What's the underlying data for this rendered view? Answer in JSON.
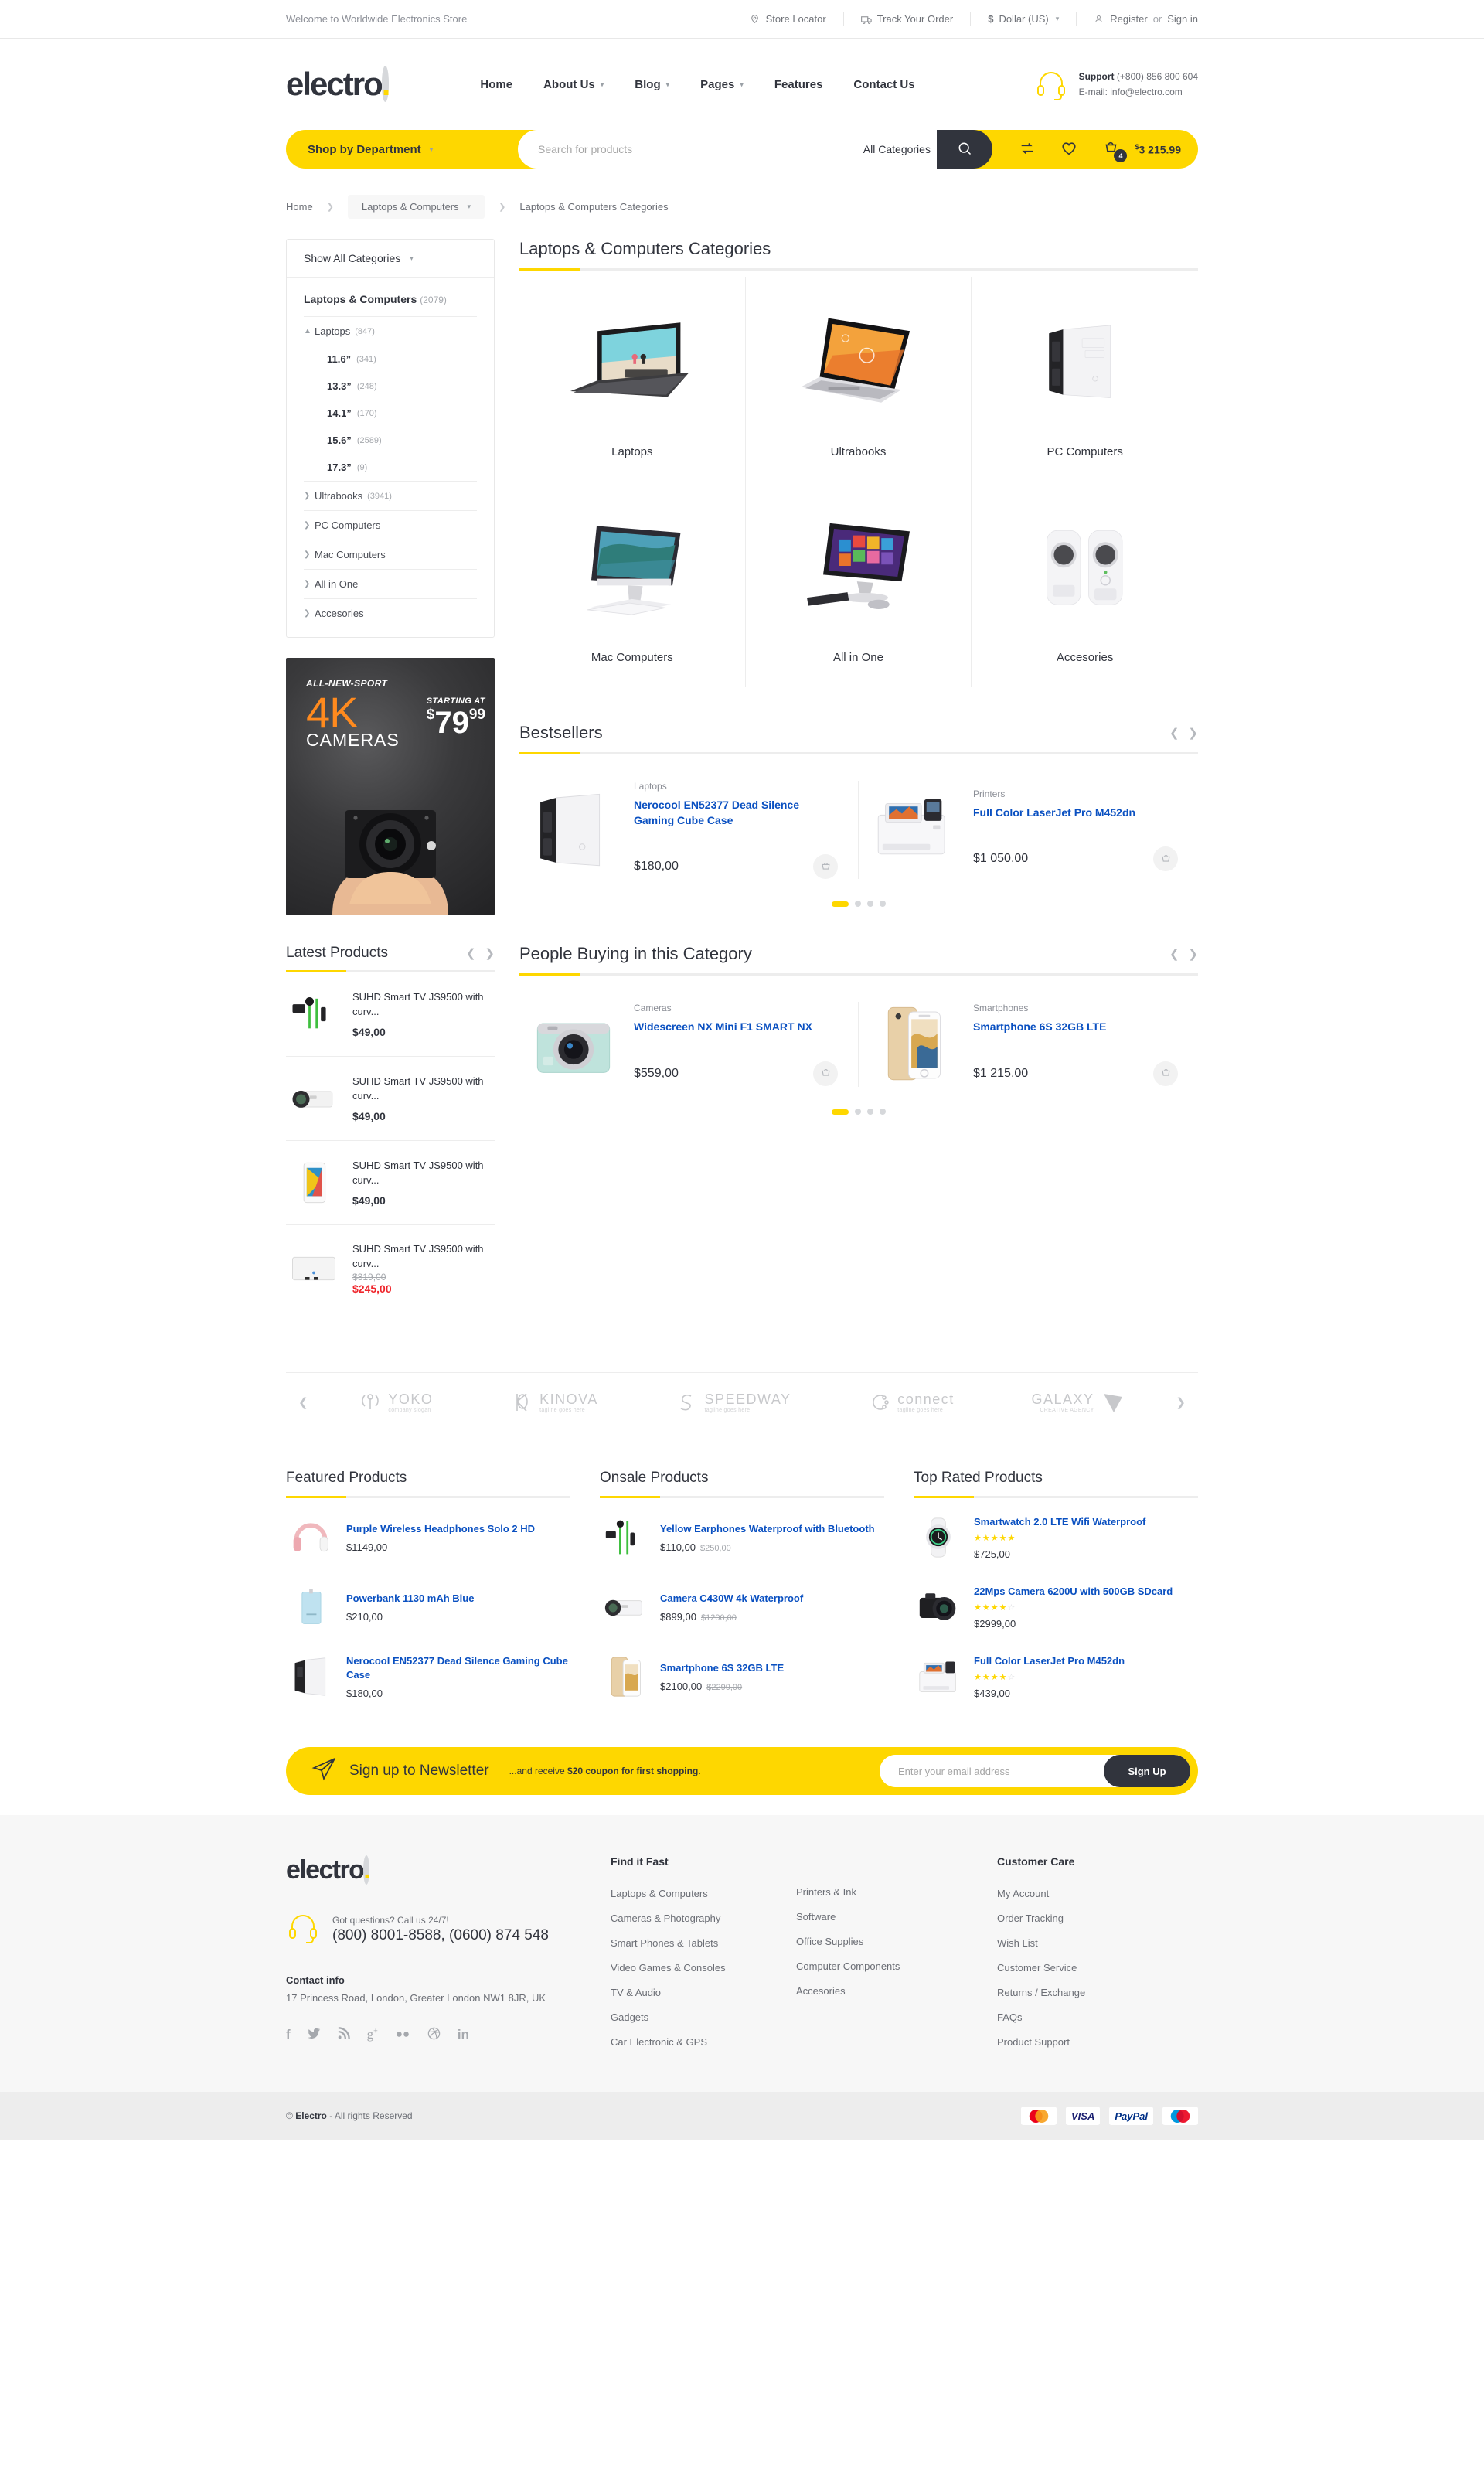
{
  "topbar": {
    "welcome": "Welcome to Worldwide Electronics Store",
    "store_locator": "Store Locator",
    "track_order": "Track Your Order",
    "currency": "Dollar (US)",
    "currency_symbol": "$",
    "register": "Register",
    "or": "or",
    "signin": "Sign in"
  },
  "header": {
    "logo": "electro",
    "logo_dot": ".",
    "nav": [
      {
        "label": "Home",
        "has_caret": false
      },
      {
        "label": "About Us",
        "has_caret": true
      },
      {
        "label": "Blog",
        "has_caret": true
      },
      {
        "label": "Pages",
        "has_caret": true
      },
      {
        "label": "Features",
        "has_caret": false
      },
      {
        "label": "Contact Us",
        "has_caret": false
      }
    ],
    "support_label": "Support",
    "support_phone": "(+800) 856 800 604",
    "support_email": "E-mail: info@electro.com"
  },
  "search": {
    "shop_by_department": "Shop by Department",
    "placeholder": "Search for products",
    "all_categories": "All Categories",
    "cart_count": "4",
    "cart_total": "3 215.99",
    "cart_currency": "$"
  },
  "breadcrumb": {
    "home": "Home",
    "current_dropdown": "Laptops & Computers",
    "page": "Laptops & Computers Categories"
  },
  "sidebar": {
    "show_all": "Show All Categories",
    "main_cat": "Laptops & Computers",
    "main_cat_count": "(2079)",
    "laptops": {
      "label": "Laptops",
      "count": "(847)"
    },
    "sizes": [
      {
        "label": "11.6”",
        "count": "(341)"
      },
      {
        "label": "13.3”",
        "count": "(248)"
      },
      {
        "label": "14.1”",
        "count": "(170)"
      },
      {
        "label": "15.6”",
        "count": "(2589)"
      },
      {
        "label": "17.3”",
        "count": "(9)"
      }
    ],
    "others": [
      {
        "label": "Ultrabooks",
        "count": "(3941)"
      },
      {
        "label": "PC Computers",
        "count": ""
      },
      {
        "label": "Mac Computers",
        "count": ""
      },
      {
        "label": "All in One",
        "count": ""
      },
      {
        "label": "Accesories",
        "count": ""
      }
    ]
  },
  "promo": {
    "kicker": "ALL-NEW-SPORT",
    "big": "4K",
    "cameras": "CAMERAS",
    "starting_at": "STARTING AT",
    "currency": "$",
    "price": "79",
    "cents": "99"
  },
  "latest_products": {
    "title": "Latest Products",
    "items": [
      {
        "name": "SUHD Smart TV JS9500 with curv...",
        "price": "$49,00",
        "old": "",
        "sale": ""
      },
      {
        "name": "SUHD Smart TV JS9500 with curv...",
        "price": "$49,00",
        "old": "",
        "sale": ""
      },
      {
        "name": "SUHD Smart TV JS9500 with curv...",
        "price": "$49,00",
        "old": "",
        "sale": ""
      },
      {
        "name": "SUHD Smart TV JS9500 with curv...",
        "price": "",
        "old": "$319,00",
        "sale": "$245,00"
      }
    ]
  },
  "categories_section": {
    "title": "Laptops & Computers Categories",
    "cards": [
      {
        "label": "Laptops"
      },
      {
        "label": "Ultrabooks"
      },
      {
        "label": "PC Computers"
      },
      {
        "label": "Mac Computers"
      },
      {
        "label": "All in One"
      },
      {
        "label": "Accesories"
      }
    ]
  },
  "bestsellers": {
    "title": "Bestsellers",
    "items": [
      {
        "category": "Laptops",
        "name": "Nerocool EN52377 Dead Silence Gaming Cube Case",
        "price": "$180,00"
      },
      {
        "category": "Printers",
        "name": "Full Color LaserJet Pro M452dn",
        "price": "$1 050,00"
      }
    ],
    "dots": 4,
    "active_dot": 0
  },
  "people_buying": {
    "title": "People Buying in this Category",
    "items": [
      {
        "category": "Cameras",
        "name": "Widescreen NX Mini F1 SMART NX",
        "price": "$559,00"
      },
      {
        "category": "Smartphones",
        "name": "Smartphone 6S 32GB LTE",
        "price": "$1 215,00"
      }
    ],
    "dots": 4,
    "active_dot": 0
  },
  "brands": [
    {
      "name": "YOKO",
      "tagline": "company slogan"
    },
    {
      "name": "KINOVA",
      "tagline": "tagline goes here"
    },
    {
      "name": "SPEEDWAY",
      "tagline": "tagline goes here"
    },
    {
      "name": "connect",
      "tagline": "tagline goes here"
    },
    {
      "name": "GALAXY",
      "tagline": "CREATIVE AGENCY"
    }
  ],
  "featured": {
    "title": "Featured Products",
    "items": [
      {
        "name": "Purple Wireless Headphones Solo 2 HD",
        "price": "$1149,00",
        "old": "",
        "stars": 0
      },
      {
        "name": "Powerbank 1130 mAh Blue",
        "price": "$210,00",
        "old": "",
        "stars": 0
      },
      {
        "name": "Nerocool EN52377 Dead Silence Gaming Cube Case",
        "price": "$180,00",
        "old": "",
        "stars": 0
      }
    ]
  },
  "onsale": {
    "title": "Onsale Products",
    "items": [
      {
        "name": "Yellow Earphones Waterproof with Bluetooth",
        "price": "$110,00",
        "old": "$250,00",
        "stars": 0
      },
      {
        "name": "Camera C430W 4k Waterproof",
        "price": "$899,00",
        "old": "$1200,00",
        "stars": 0
      },
      {
        "name": "Smartphone 6S 32GB LTE",
        "price": "$2100,00",
        "old": "$2299,00",
        "stars": 0
      }
    ]
  },
  "toprated": {
    "title": "Top Rated Products",
    "items": [
      {
        "name": "Smartwatch 2.0 LTE Wifi Waterproof",
        "price": "$725,00",
        "old": "",
        "stars": 5
      },
      {
        "name": "22Mps Camera 6200U with 500GB SDcard",
        "price": "$2999,00",
        "old": "",
        "stars": 4
      },
      {
        "name": "Full Color LaserJet Pro M452dn",
        "price": "$439,00",
        "old": "",
        "stars": 4
      }
    ]
  },
  "newsletter": {
    "title": "Sign up to Newsletter",
    "subtitle_pre": "...and receive ",
    "subtitle_bold": "$20 coupon for first shopping.",
    "placeholder": "Enter your email address",
    "button": "Sign Up"
  },
  "footer": {
    "logo": "electro",
    "logo_dot": ".",
    "questions": "Got questions? Call us 24/7!",
    "phone": "(800) 8001-8588, (0600) 874 548",
    "contact_title": "Contact info",
    "address": "17 Princess Road, London, Greater London NW1 8JR, UK",
    "social": [
      "facebook-icon",
      "twitter-icon",
      "rss-icon",
      "google-plus-icon",
      "flickr-icon",
      "dribbble-icon",
      "linkedin-icon"
    ],
    "find_it_fast_title": "Find it Fast",
    "find_it_fast_col1": [
      "Laptops & Computers",
      "Cameras & Photography",
      "Smart Phones & Tablets",
      "Video Games & Consoles",
      "TV & Audio",
      "Gadgets",
      "Car Electronic & GPS"
    ],
    "find_it_fast_col2": [
      "Printers & Ink",
      "Software",
      "Office Supplies",
      "Computer Components",
      "Accesories"
    ],
    "customer_care_title": "Customer Care",
    "customer_care": [
      "My Account",
      "Order Tracking",
      "Wish List",
      "Customer Service",
      "Returns / Exchange",
      "FAQs",
      "Product Support"
    ]
  },
  "copyright": {
    "pre": "© ",
    "brand": "Electro",
    "post": " - All rights Reserved",
    "payments": [
      "MasterCard",
      "VISA",
      "PayPal",
      "Maestro"
    ]
  },
  "colors": {
    "accent": "#fed700",
    "dark": "#31343d",
    "link": "#0a50c1",
    "sale": "#ef262c"
  }
}
